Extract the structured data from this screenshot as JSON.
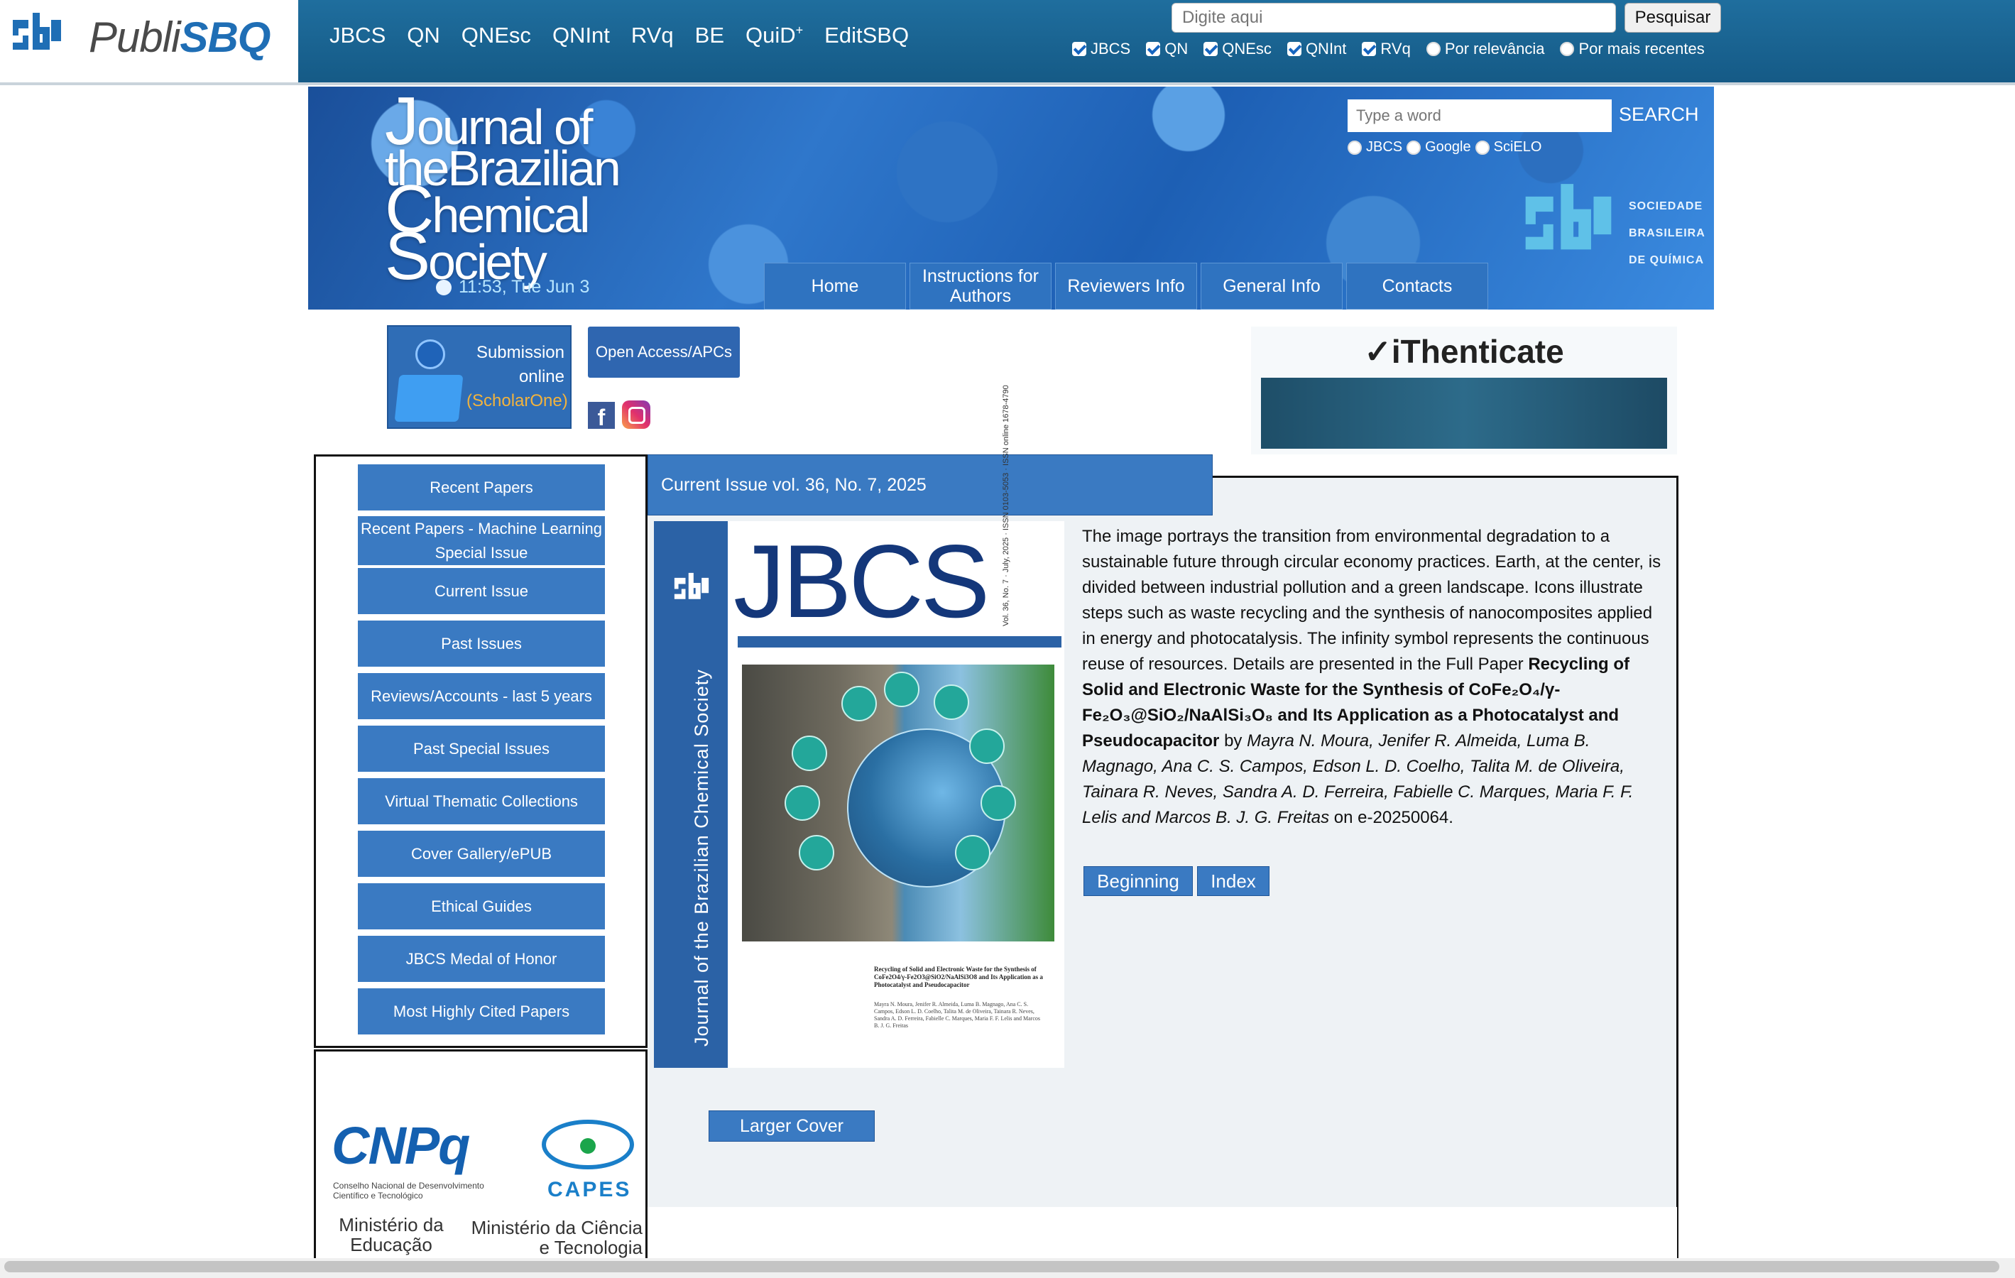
{
  "topbar": {
    "logo_prefix": "Publi",
    "logo_brand": "SBQ",
    "nav": [
      "JBCS",
      "QN",
      "QNEsc",
      "QNInt",
      "RVq",
      "BE",
      "QuiD",
      "EditSBQ"
    ],
    "quid_sup": "+",
    "search_placeholder": "Digite aqui",
    "search_button": "Pesquisar",
    "filters": [
      {
        "label": "JBCS",
        "checked": true
      },
      {
        "label": "QN",
        "checked": true
      },
      {
        "label": "QNEsc",
        "checked": true
      },
      {
        "label": "QNInt",
        "checked": true
      },
      {
        "label": "RVq",
        "checked": true
      }
    ],
    "sort_options": [
      "Por relevância",
      "Por mais recentes"
    ]
  },
  "banner": {
    "title_lines": [
      {
        "cap": "J",
        "rest": "ournal of"
      },
      {
        "cap": "",
        "rest": "theBrazilian",
        "capmid": "B"
      },
      {
        "cap": "C",
        "rest": "hemical"
      },
      {
        "cap": "S",
        "rest": "ociety"
      }
    ],
    "clock": "11:53, Tue Jun 3",
    "search_placeholder": "Type a word",
    "search_button": "SEARCH",
    "search_scopes": [
      "JBCS",
      "Google",
      "SciELO"
    ],
    "sbq_lines": [
      "SOCIEDADE",
      "BRASILEIRA",
      "DE QUÍMICA"
    ],
    "nav": [
      "Home",
      "Instructions for Authors",
      "Reviewers Info",
      "General Info",
      "Contacts"
    ]
  },
  "actions": {
    "submission": [
      "Submission",
      "online",
      "(ScholarOne)"
    ],
    "open_access": "Open Access/APCs",
    "ithenticate": "✓iThenticate"
  },
  "sidebar": {
    "items": [
      "Recent Papers",
      "Recent Papers - Machine Learning Special Issue",
      "Current Issue",
      "Past Issues",
      "Reviews/Accounts - last 5 years",
      "Past Special Issues",
      "Virtual Thematic Collections",
      "Cover Gallery/ePUB",
      "Ethical Guides",
      "JBCS Medal of Honor",
      "Most Highly Cited Papers"
    ]
  },
  "funders": {
    "cnpq": "CNPq",
    "cnpq_sub": "Conselho Nacional de Desenvolvimento Científico e Tecnológico",
    "capes": "CAPES",
    "min_edu": "Ministério da Educação",
    "min_cien": "Ministério da Ciência e Tecnologia"
  },
  "main": {
    "issue_tab": "Current Issue vol. 36, No. 7, 2025",
    "cover": {
      "spine": "Journal of the Brazilian Chemical Society",
      "title": "JBCS",
      "vol": "Vol. 36, No. 7 · July, 2025 · ISSN 0103-5053 · ISSN online 1678-4790",
      "caption": "Recycling of Solid and Electronic Waste for the Synthesis of CoFe2O4/γ-Fe2O3@SiO2/NaAlSi3O8 and Its Application as a Photocatalyst and Pseudocapacitor",
      "authors": "Mayra N. Moura, Jenifer R. Almeida, Luma B. Magnago, Ana C. S. Campos, Edson L. D. Coelho, Talita M. de Oliveira, Tainara R. Neves, Sandra A. D. Ferreira, Fabielle C. Marques, Maria F. F. Lelis and Marcos B. J. G. Freitas"
    },
    "description_intro": "The image portrays the transition from environmental degradation to a sustainable future through circular economy practices. Earth, at the center, is divided between industrial pollution and a green landscape. Icons illustrate steps such as waste recycling and the synthesis of nanocomposites applied in energy and photocatalysis. The infinity symbol represents the continuous reuse of resources. Details are presented in the Full Paper",
    "paper_title": "Recycling of Solid and Electronic Waste for the Synthesis of CoFe₂O₄/γ-Fe₂O₃@SiO₂/NaAlSi₃O₈ and Its Application as a Photocatalyst and Pseudocapacitor",
    "by": "by",
    "authors": "Mayra N. Moura, Jenifer R. Almeida, Luma B. Magnago, Ana C. S. Campos, Edson L. D. Coelho, Talita M. de Oliveira, Tainara R. Neves, Sandra A. D. Ferreira, Fabielle C. Marques, Maria F. F. Lelis and Marcos B. J. G. Freitas",
    "on_article": "on e-20250064.",
    "btn_beginning": "Beginning",
    "btn_index": "Index",
    "btn_larger_cover": "Larger Cover"
  }
}
